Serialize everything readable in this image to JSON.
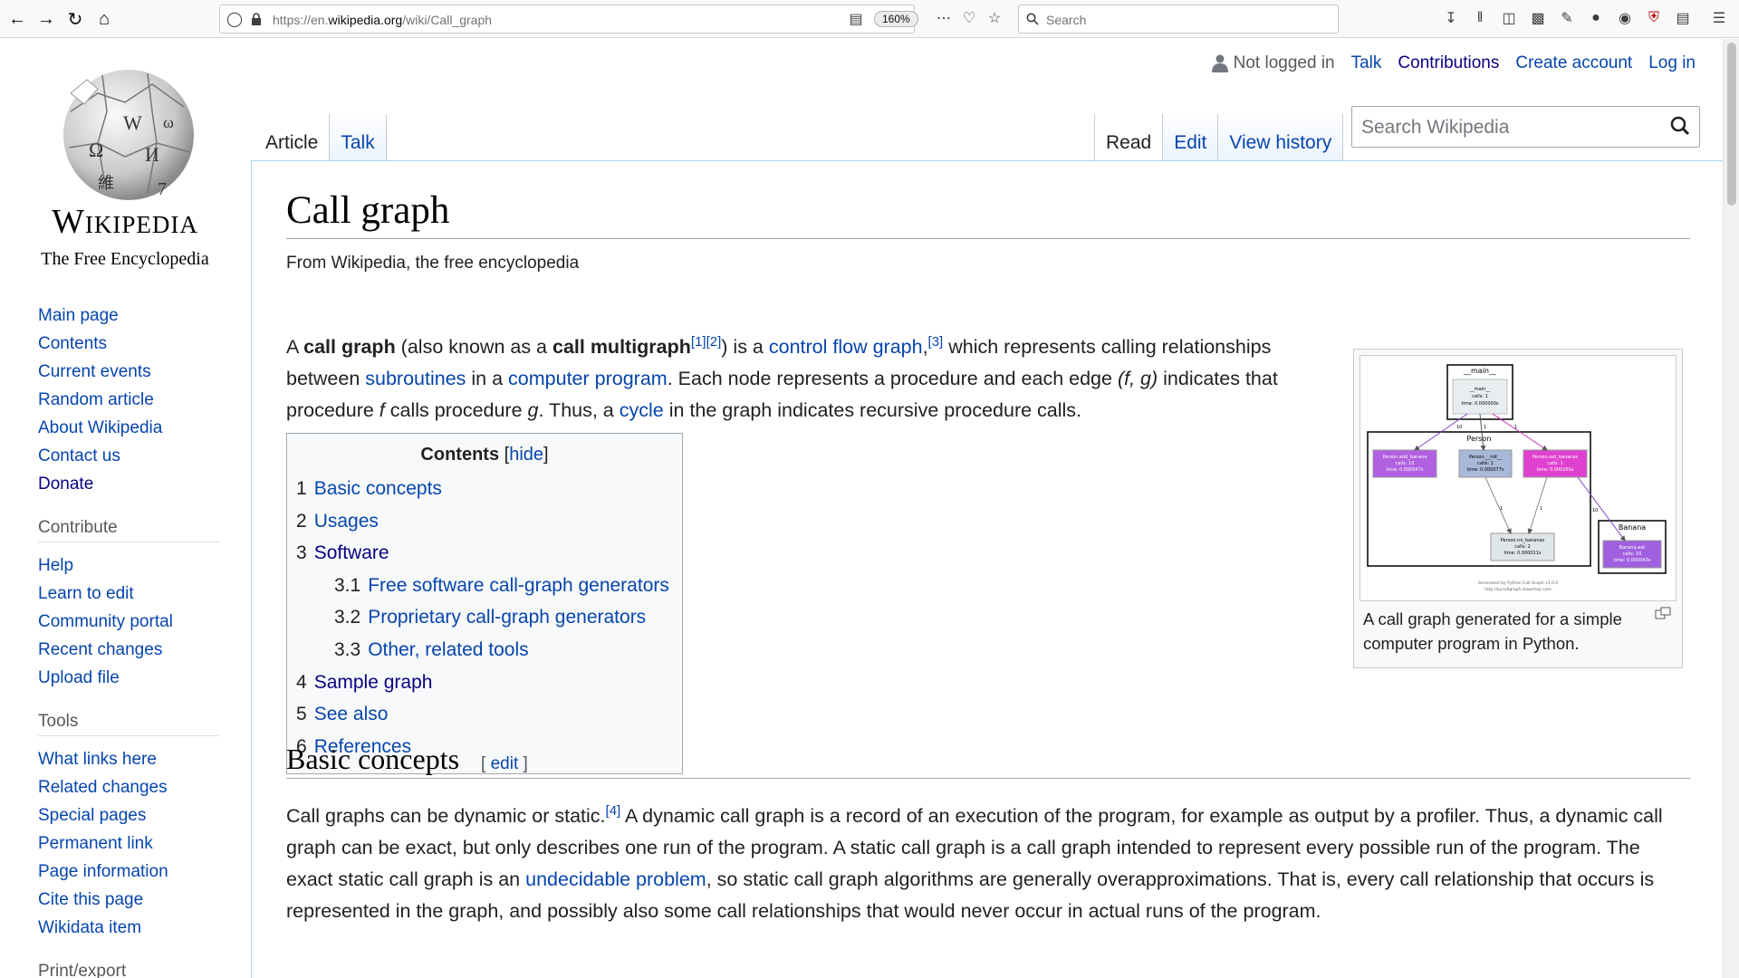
{
  "browser": {
    "url_prefix": "https://en.",
    "url_domain": "wikipedia.org",
    "url_path": "/wiki/Call_graph",
    "zoom": "160%",
    "search_placeholder": "Search"
  },
  "personal": {
    "not_logged_in": "Not logged in",
    "talk": "Talk",
    "contributions": "Contributions",
    "create_account": "Create account",
    "log_in": "Log in"
  },
  "logo": {
    "wordmark": "Wikipedia",
    "tagline": "The Free Encyclopedia"
  },
  "tabs": {
    "article": "Article",
    "talk": "Talk",
    "read": "Read",
    "edit": "Edit",
    "history": "View history",
    "search_placeholder": "Search Wikipedia"
  },
  "sidebar": {
    "nav": [
      "Main page",
      "Contents",
      "Current events",
      "Random article",
      "About Wikipedia",
      "Contact us",
      "Donate"
    ],
    "contribute_heading": "Contribute",
    "contribute": [
      "Help",
      "Learn to edit",
      "Community portal",
      "Recent changes",
      "Upload file"
    ],
    "tools_heading": "Tools",
    "tools": [
      "What links here",
      "Related changes",
      "Special pages",
      "Permanent link",
      "Page information",
      "Cite this page",
      "Wikidata item"
    ],
    "print_heading": "Print/export"
  },
  "article": {
    "title": "Call graph",
    "subtitle": "From Wikipedia, the free encyclopedia",
    "lead": {
      "t1": "A ",
      "b1": "call graph",
      "t2": " (also known as a ",
      "b2": "call multigraph",
      "ref1": "[1]",
      "ref2": "[2]",
      "t3": ") is a ",
      "l1": "control flow graph",
      "t4": ",",
      "ref3": "[3]",
      "t5": " which represents calling relationships between ",
      "l2": "subroutines",
      "t6": " in a ",
      "l3": "computer program",
      "t7": ". Each node represents a procedure and each edge ",
      "i1": "(f, g)",
      "t8": " indicates that procedure ",
      "i2": "f",
      "t9": " calls procedure ",
      "i3": "g",
      "t10": ". Thus, a ",
      "l4": "cycle",
      "t11": " in the graph indicates recursive procedure calls."
    },
    "toc": {
      "title": "Contents",
      "hide": "hide",
      "items": [
        {
          "num": "1",
          "label": "Basic concepts"
        },
        {
          "num": "2",
          "label": "Usages"
        },
        {
          "num": "3",
          "label": "Software"
        },
        {
          "num": "3.1",
          "label": "Free software call-graph generators"
        },
        {
          "num": "3.2",
          "label": "Proprietary call-graph generators"
        },
        {
          "num": "3.3",
          "label": "Other, related tools"
        },
        {
          "num": "4",
          "label": "Sample graph"
        },
        {
          "num": "5",
          "label": "See also"
        },
        {
          "num": "6",
          "label": "References"
        }
      ]
    },
    "thumb": {
      "caption": "A call graph generated for a simple computer program in Python.",
      "graph": {
        "main_cluster": "__main__",
        "main_node": [
          "__main__",
          "calls: 1",
          "time: 0.000000s"
        ],
        "person_cluster": "Person",
        "add_bananas": [
          "Person.add_banana",
          "calls: 10",
          "time: 0.000047s"
        ],
        "init": [
          "Person.__init__",
          "calls: 1",
          "time: 0.000077s"
        ],
        "eat_bananas": [
          "Person.eat_bananas",
          "calls: 1",
          "time: 0.000265s"
        ],
        "no_bananas": [
          "Person.no_bananas",
          "calls: 2",
          "time: 0.000011s"
        ],
        "banana_cluster": "Banana",
        "banana_eat": [
          "Banana.eat",
          "calls: 10",
          "time: 0.000043s"
        ],
        "edge_labels": [
          "10",
          "1",
          "1",
          "1",
          "1",
          "10"
        ],
        "footer1": "Generated by Python Call Graph v1.0.0",
        "footer2": "http://pycallgraph.slowchop.com"
      }
    },
    "section1": {
      "heading": "Basic concepts",
      "edit": "edit",
      "t1": "Call graphs can be dynamic or static.",
      "ref4": "[4]",
      "t2": " A dynamic call graph is a record of an execution of the program, for example as output by a profiler. Thus, a dynamic call graph can be exact, but only describes one run of the program. A static call graph is a call graph intended to represent every possible run of the program. The exact static call graph is an ",
      "l1": "undecidable problem",
      "t3": ", so static call graph algorithms are generally overapproximations. That is, every call relationship that occurs is represented in the graph, and possibly also some call relationships that would never occur in actual runs of the program."
    }
  }
}
